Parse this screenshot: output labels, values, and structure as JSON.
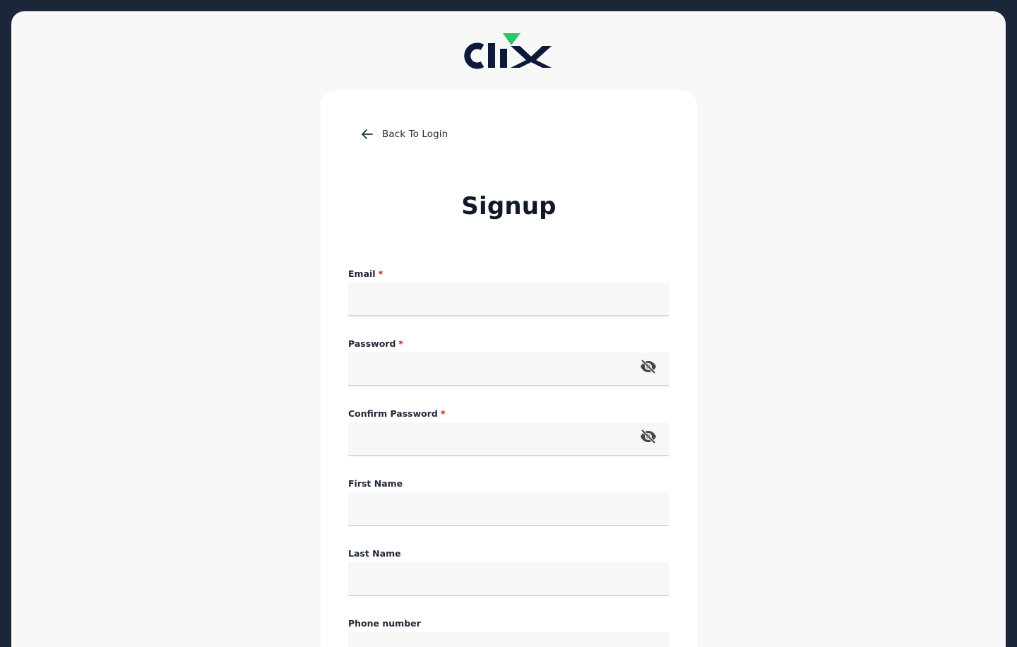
{
  "brand": {
    "logo_text": "clix",
    "colors": {
      "navy": "#0c1a3a",
      "green": "#2ec36b"
    }
  },
  "nav": {
    "back_label": "Back To Login"
  },
  "form": {
    "title": "Signup",
    "fields": [
      {
        "label": "Email",
        "required": true,
        "required_marker": "*",
        "value": "",
        "placeholder": ""
      },
      {
        "label": "Password",
        "required": true,
        "required_marker": "*",
        "value": "",
        "placeholder": "",
        "icon": "eye-off-icon"
      },
      {
        "label": "Confirm Password",
        "required": true,
        "required_marker": "*",
        "value": "",
        "placeholder": "",
        "icon": "eye-off-icon"
      },
      {
        "label": "First Name",
        "required": false,
        "value": "",
        "placeholder": ""
      },
      {
        "label": "Last Name",
        "required": false,
        "value": "",
        "placeholder": ""
      },
      {
        "label": "Phone number",
        "required": false,
        "value": "",
        "placeholder": ""
      }
    ]
  }
}
